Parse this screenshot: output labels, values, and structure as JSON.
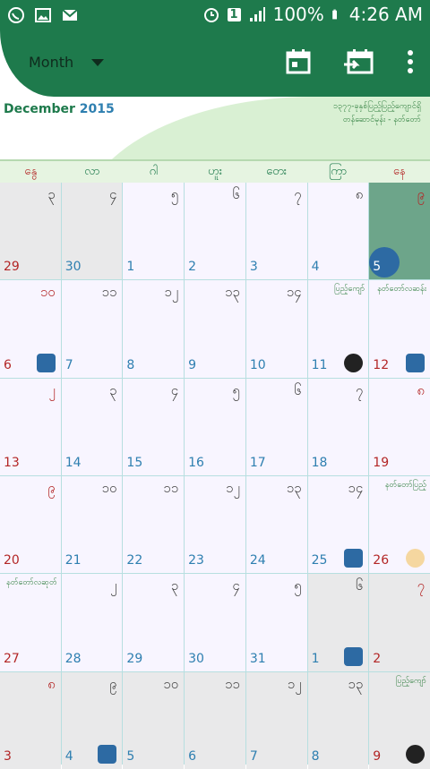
{
  "status_bar": {
    "battery": "100%",
    "time": "4:26 AM",
    "sim": "1"
  },
  "app_bar": {
    "view_label": "Month"
  },
  "month_header": {
    "month": "December",
    "year": "2015",
    "myanmar_line1": "၁၃၇၇-ခုနှစ်ပြည့်ပြည့်ကျောင်ရှိ",
    "myanmar_line2": "တန်ဆောင်မုန်း - နတ်တော်"
  },
  "weekdays": [
    "နွေ",
    "လာ",
    "ဂါ",
    "ဟူး",
    "တေး",
    "ကြာ",
    "နေ"
  ],
  "weeks": [
    [
      {
        "mm": "၃",
        "greg": "29",
        "style": "gray",
        "mm_red": false,
        "greg_red": true
      },
      {
        "mm": "၄",
        "greg": "30",
        "style": "gray"
      },
      {
        "mm": "၅",
        "greg": "1"
      },
      {
        "mm": "၆",
        "greg": "2"
      },
      {
        "mm": "၇",
        "greg": "3"
      },
      {
        "mm": "၈",
        "greg": "4"
      },
      {
        "mm": "၉",
        "greg": "5",
        "style": "today",
        "mm_red": true
      }
    ],
    [
      {
        "mm": "၁၀",
        "greg": "6",
        "greg_red": true,
        "mm_red": true,
        "marker": "square"
      },
      {
        "mm": "၁၁",
        "greg": "7"
      },
      {
        "mm": "၁၂",
        "greg": "8"
      },
      {
        "mm": "၁၃",
        "greg": "9"
      },
      {
        "mm": "၁၄",
        "greg": "10"
      },
      {
        "mm": "ပြည့်ကျော်",
        "greg": "11",
        "mm_small": true,
        "marker": "dot"
      },
      {
        "mm": "နတ်တော်လဆန်း",
        "greg": "12",
        "greg_red": true,
        "mm_small": true,
        "marker": "square"
      }
    ],
    [
      {
        "mm": "၂",
        "greg": "13",
        "greg_red": true,
        "mm_red": true
      },
      {
        "mm": "၃",
        "greg": "14"
      },
      {
        "mm": "၄",
        "greg": "15"
      },
      {
        "mm": "၅",
        "greg": "16"
      },
      {
        "mm": "၆",
        "greg": "17"
      },
      {
        "mm": "၇",
        "greg": "18"
      },
      {
        "mm": "၈",
        "greg": "19",
        "greg_red": true,
        "mm_red": true
      }
    ],
    [
      {
        "mm": "၉",
        "greg": "20",
        "greg_red": true,
        "mm_red": true
      },
      {
        "mm": "၁၀",
        "greg": "21"
      },
      {
        "mm": "၁၁",
        "greg": "22"
      },
      {
        "mm": "၁၂",
        "greg": "23"
      },
      {
        "mm": "၁၃",
        "greg": "24"
      },
      {
        "mm": "၁၄",
        "greg": "25",
        "marker": "square"
      },
      {
        "mm": "နတ်တော်ပြည့်",
        "greg": "26",
        "greg_red": true,
        "mm_small": true,
        "marker": "yellow"
      }
    ],
    [
      {
        "mm": "နတ်တော်လဆုတ်",
        "greg": "27",
        "greg_red": true,
        "mm_small": true
      },
      {
        "mm": "၂",
        "greg": "28"
      },
      {
        "mm": "၃",
        "greg": "29"
      },
      {
        "mm": "၄",
        "greg": "30"
      },
      {
        "mm": "၅",
        "greg": "31"
      },
      {
        "mm": "၆",
        "greg": "1",
        "style": "gray",
        "marker": "square"
      },
      {
        "mm": "၇",
        "greg": "2",
        "style": "gray",
        "greg_red": true,
        "mm_red": true
      }
    ],
    [
      {
        "mm": "၈",
        "greg": "3",
        "style": "gray",
        "greg_red": true,
        "mm_red": true
      },
      {
        "mm": "၉",
        "greg": "4",
        "style": "gray",
        "marker": "square"
      },
      {
        "mm": "၁၀",
        "greg": "5",
        "style": "gray"
      },
      {
        "mm": "၁၁",
        "greg": "6",
        "style": "gray"
      },
      {
        "mm": "၁၂",
        "greg": "7",
        "style": "gray"
      },
      {
        "mm": "၁၃",
        "greg": "8",
        "style": "gray"
      },
      {
        "mm": "ပြည့်ကျော်",
        "greg": "9",
        "style": "gray",
        "greg_red": true,
        "mm_small": true,
        "marker": "dot"
      }
    ]
  ],
  "colors": {
    "primary": "#1e7a4c",
    "weekday_bg": "#e6f4e1",
    "sunday_red": "#b32626",
    "greg_blue": "#2e7fb0",
    "marker_blue": "#2d6aa3"
  }
}
